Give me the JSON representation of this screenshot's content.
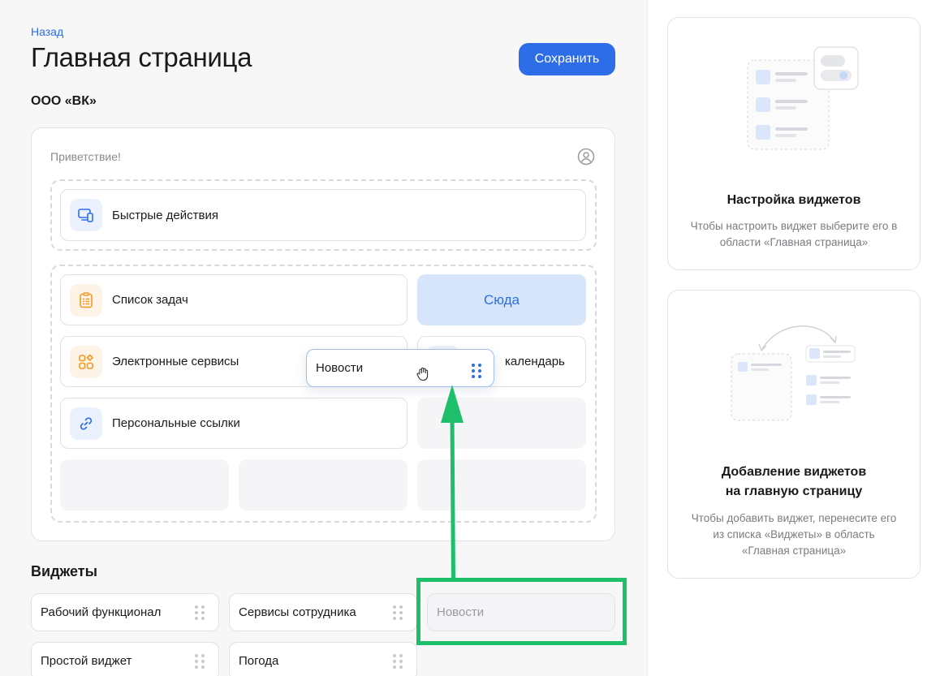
{
  "header": {
    "back_label": "Назад",
    "title": "Главная страница",
    "save_label": "Сохранить",
    "org_name": "ООО «ВК»"
  },
  "home_card": {
    "greeting": "Приветствие!",
    "quick_actions": "Быстрые действия",
    "tasks": "Список задач",
    "drop_here": "Сюда",
    "services": "Электронные сервисы",
    "calendar_partial": "календарь",
    "links": "Персональные ссылки",
    "dragged_label": "Новости"
  },
  "widgets": {
    "title": "Виджеты",
    "items": [
      {
        "label": "Рабочий функционал"
      },
      {
        "label": "Сервисы сотрудника"
      },
      {
        "label": "Новости"
      },
      {
        "label": "Простой виджет"
      },
      {
        "label": "Погода"
      }
    ]
  },
  "info_cards": [
    {
      "title": "Настройка виджетов",
      "text": "Чтобы настроить виджет выберите его в области «Главная страница»"
    },
    {
      "title_line1": "Добавление виджетов",
      "title_line2": "на главную страницу",
      "text_line1": "Чтобы добавить виджет, перенесите его",
      "text_line2": "из списка «Виджеты» в область",
      "text_line3": "«Главная страница»"
    }
  ],
  "colors": {
    "accent": "#2d6ee8",
    "drop_target_bg": "#d7e5fb",
    "annotation_green": "#1dbf6b"
  }
}
